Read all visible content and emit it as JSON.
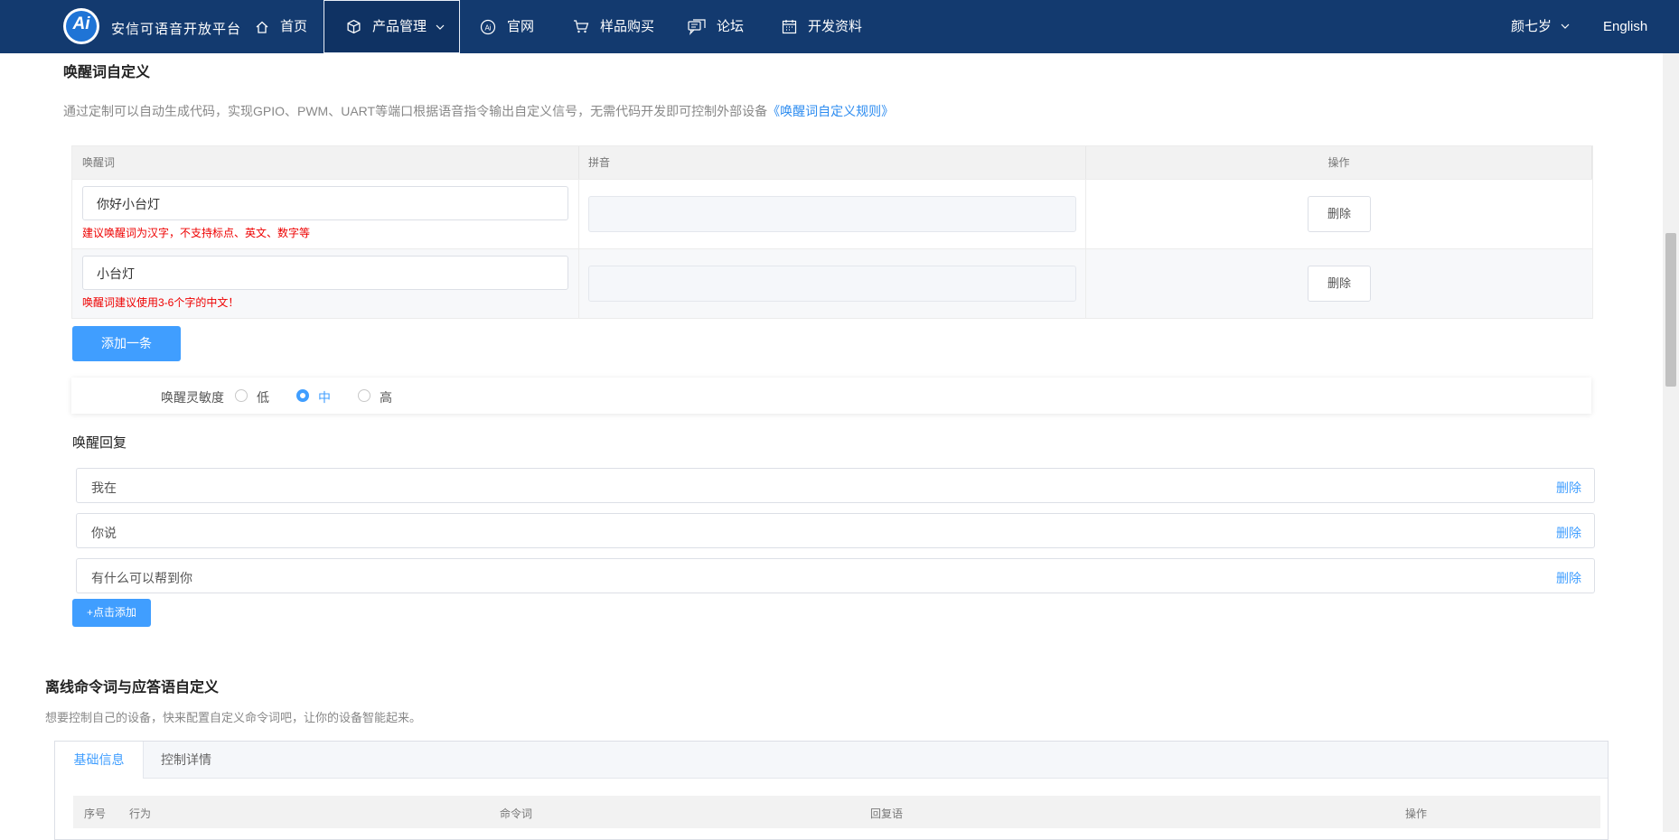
{
  "nav": {
    "logo_text": "Ai",
    "brand": "安信可语音开放平台",
    "items": [
      {
        "label": "首页",
        "icon": "home-icon"
      },
      {
        "label": "产品管理",
        "icon": "cube-icon"
      },
      {
        "label": "官网",
        "icon": "ai-circle-icon"
      },
      {
        "label": "样品购买",
        "icon": "cart-icon"
      },
      {
        "label": "论坛",
        "icon": "chat-icon"
      },
      {
        "label": "开发资料",
        "icon": "calendar-icon"
      }
    ],
    "user": "颜七岁",
    "language": "English"
  },
  "wake": {
    "title": "唤醒词自定义",
    "desc": "通过定制可以自动生成代码，实现GPIO、PWM、UART等端口根据语音指令输出自定义信号，无需代码开发即可控制外部设备",
    "rule_link": "《唤醒词自定义规则》",
    "headers": {
      "word": "唤醒词",
      "pinyin": "拼音",
      "ops": "操作"
    },
    "rows": [
      {
        "word": "你好小台灯",
        "error": "建议唤醒词为汉字，不支持标点、英文、数字等",
        "pinyin": "",
        "action": "删除"
      },
      {
        "word": "小台灯",
        "error": "唤醒词建议使用3-6个字的中文！",
        "pinyin": "",
        "action": "删除"
      }
    ],
    "add_button": "添加一条",
    "sensitivity": {
      "label": "唤醒灵敏度",
      "options": [
        "低",
        "中",
        "高"
      ],
      "selected": "中"
    }
  },
  "reply": {
    "title": "唤醒回复",
    "items": [
      {
        "text": "我在",
        "action": "删除"
      },
      {
        "text": "你说",
        "action": "删除"
      },
      {
        "text": "有什么可以帮到你",
        "action": "删除"
      }
    ],
    "add_button": "+点击添加"
  },
  "offline": {
    "title": "离线命令词与应答语自定义",
    "desc": "想要控制自己的设备，快来配置自定义命令词吧，让你的设备智能起来。",
    "tabs": [
      "基础信息",
      "控制详情"
    ],
    "active_tab": "基础信息",
    "headers": {
      "index": "序号",
      "behavior": "行为",
      "command": "命令词",
      "reply": "回复语",
      "ops": "操作"
    }
  },
  "colors": {
    "nav_bg": "#133a6f",
    "primary": "#409eff",
    "error": "#e00000"
  }
}
